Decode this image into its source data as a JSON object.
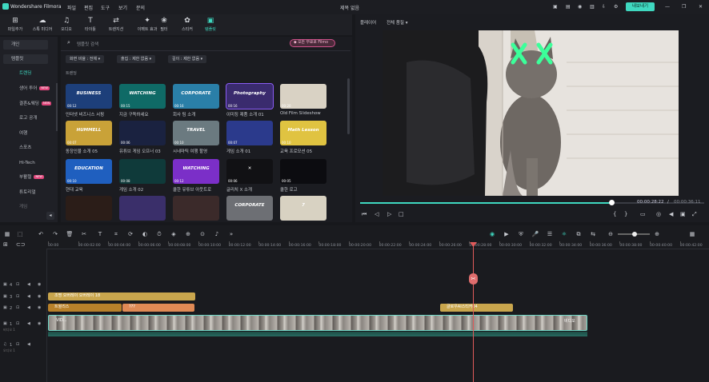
{
  "app": {
    "title": "Wondershare Filmora",
    "project_title": "제목 없음",
    "export_label": "내보내기"
  },
  "menu": [
    "파일",
    "편집",
    "도구",
    "보기",
    "문의"
  ],
  "toolbar": [
    {
      "label": "파일추가",
      "icon": "import-icon",
      "glyph": "⊞"
    },
    {
      "label": "스톡 미디어",
      "icon": "stock-media-icon",
      "glyph": "☁"
    },
    {
      "label": "오디오",
      "icon": "music-icon",
      "glyph": "♫"
    },
    {
      "label": "타이틀",
      "icon": "title-icon",
      "glyph": "T"
    },
    {
      "label": "트랜지션",
      "icon": "transition-icon",
      "glyph": "⇄"
    },
    {
      "label": "이펙트 효과",
      "icon": "effects-icon",
      "glyph": "✦"
    },
    {
      "label": "필터",
      "icon": "filter-icon",
      "glyph": "❀"
    },
    {
      "label": "스티커",
      "icon": "sticker-icon",
      "glyph": "✿"
    },
    {
      "label": "템플릿",
      "icon": "template-icon",
      "glyph": "▣"
    }
  ],
  "sidebar": {
    "mine": "개인",
    "templates": "템플릿",
    "items": [
      {
        "label": "트렌딩",
        "new": false
      },
      {
        "label": "생어 투어",
        "new": true
      },
      {
        "label": "결혼&웨딩",
        "new": true
      },
      {
        "label": "로고 공개",
        "new": false
      },
      {
        "label": "여행",
        "new": false
      },
      {
        "label": "스포츠",
        "new": false
      },
      {
        "label": "Hi-Tech",
        "new": false
      },
      {
        "label": "부활절",
        "new": true
      },
      {
        "label": "튜토리얼",
        "new": false
      },
      {
        "label": "게임",
        "new": false
      }
    ],
    "new_badge": "NEW"
  },
  "search": {
    "placeholder": "템플릿 검색",
    "promo": "모든 무료로 Filmo"
  },
  "filters": [
    "화면 비율 : 전체",
    "출집 : 제한 없음",
    "길이 : 제한 없음"
  ],
  "section_label": "트렌딩",
  "templates": [
    {
      "title": "인터넷 비즈니스 서핑",
      "dur": "00:12",
      "color": "#1d3f7a",
      "text": "BUSINESS"
    },
    {
      "title": "지금 구독하세요",
      "dur": "00:15",
      "color": "#0f6a66",
      "text": "WATCHING"
    },
    {
      "title": "회사 팀 소개",
      "dur": "00:16",
      "color": "#2a7fa8",
      "text": "CORPORATE"
    },
    {
      "title": "이미징 제품 소개 01",
      "dur": "00:16",
      "color": "#3a2b6e",
      "text": "Photography"
    },
    {
      "title": "Old Film Slideshow",
      "dur": "00:20",
      "color": "#d9d2c4",
      "text": ""
    },
    {
      "title": "동장인물 소개 05",
      "dur": "00:07",
      "color": "#c9a238",
      "text": "HUMMELL"
    },
    {
      "title": "유튜브 게임 오프너 03",
      "dur": "00:06",
      "color": "#1a2240",
      "text": ""
    },
    {
      "title": "시네마틱 여행 할영",
      "dur": "00:10",
      "color": "#6b7a80",
      "text": "TRAVEL"
    },
    {
      "title": "게임 소개 01",
      "dur": "00:07",
      "color": "#2b3a8c",
      "text": ""
    },
    {
      "title": "교육 프로모션 05",
      "dur": "00:10",
      "color": "#e0c341",
      "text": "Math Lesson"
    },
    {
      "title": "현대 교육",
      "dur": "00:10",
      "color": "#1f5fbf",
      "text": "EDUCATION"
    },
    {
      "title": "게임 소개 02",
      "dur": "00:08",
      "color": "#0f3a3a",
      "text": ""
    },
    {
      "title": "쿨한 유튜브 아웃트로",
      "dur": "00:12",
      "color": "#7b2fc8",
      "text": "WATCHING"
    },
    {
      "title": "글리치 X 소개",
      "dur": "00:06",
      "color": "#111114",
      "text": "✕"
    },
    {
      "title": "쿨한 로고",
      "dur": "00:05",
      "color": "#0c0c10",
      "text": ""
    },
    {
      "title": "",
      "dur": "",
      "color": "#2b1d18",
      "text": ""
    },
    {
      "title": "",
      "dur": "",
      "color": "#3a2f6a",
      "text": ""
    },
    {
      "title": "",
      "dur": "",
      "color": "#3b2a2a",
      "text": ""
    },
    {
      "title": "",
      "dur": "",
      "color": "#6d6f74",
      "text": "CORPORATE"
    },
    {
      "title": "",
      "dur": "",
      "color": "#d8d2c2",
      "text": "7"
    }
  ],
  "player": {
    "tab": "플레이어",
    "quality": "전체 품질",
    "current": "00:00:28:22",
    "total": "00:00:36:11",
    "progress": 0.73
  },
  "timeline": {
    "ticks": [
      "00:00",
      "00:00:02:00",
      "00:00:04:00",
      "00:00:06:00",
      "00:00:08:00",
      "00:00:10:00",
      "00:00:12:00",
      "00:00:14:00",
      "00:00:16:00",
      "00:00:18:00",
      "00:00:20:00",
      "00:00:22:00",
      "00:00:24:00",
      "00:00:26:00",
      "00:00:28:00",
      "00:00:30:00",
      "00:00:32:00",
      "00:00:34:00",
      "00:00:36:00",
      "00:00:38:00",
      "00:00:40:00",
      "00:00:42:00",
      "00:00:44:00"
    ],
    "clips": {
      "overlay": "조명 오버레이 오버레이 18",
      "title1": "트윌리스",
      "title2": "???",
      "title3": "글로우AI스티커04",
      "video_label": "VID...",
      "video_name": "비디오"
    },
    "tracks": [
      "4",
      "3",
      "2",
      "1",
      "1"
    ],
    "track_video": "비디오 1",
    "track_audio": "오디오 1"
  }
}
